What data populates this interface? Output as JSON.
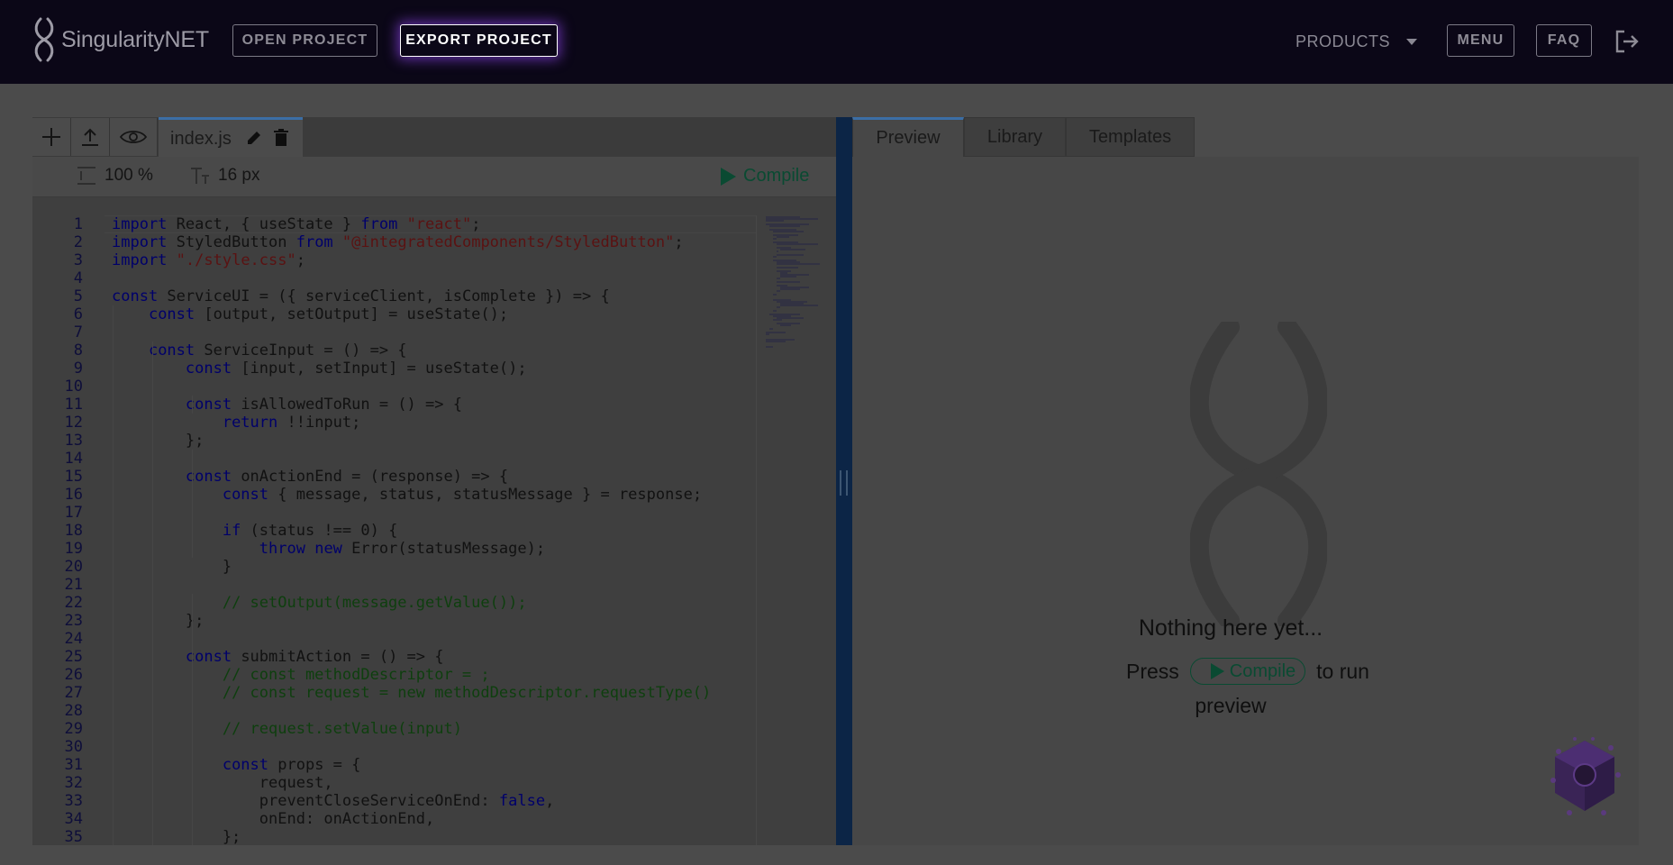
{
  "header": {
    "brand": "SingularityNET",
    "open_project": "OPEN PROJECT",
    "export_project": "EXPORT PROJECT",
    "products": "PRODUCTS",
    "menu": "MENU",
    "faq": "FAQ"
  },
  "editor": {
    "tab_filename": "index.js",
    "zoom": "100 %",
    "font_size": "16 px",
    "compile_label": "Compile",
    "code_lines": [
      "import React, { useState } from \"react\";",
      "import StyledButton from \"@integratedComponents/StyledButton\";",
      "import \"./style.css\";",
      "",
      "const ServiceUI = ({ serviceClient, isComplete }) => {",
      "    const [output, setOutput] = useState();",
      "",
      "    const ServiceInput = () => {",
      "        const [input, setInput] = useState();",
      "",
      "        const isAllowedToRun = () => {",
      "            return !!input;",
      "        };",
      "",
      "        const onActionEnd = (response) => {",
      "            const { message, status, statusMessage } = response;",
      "",
      "            if (status !== 0) {",
      "                throw new Error(statusMessage);",
      "            }",
      "",
      "            // setOutput(message.getValue());",
      "        };",
      "",
      "        const submitAction = () => {",
      "            // const methodDescriptor = ;",
      "            // const request = new methodDescriptor.requestType()",
      "",
      "            // request.setValue(input)",
      "",
      "            const props = {",
      "                request,",
      "                preventCloseServiceOnEnd: false,",
      "                onEnd: onActionEnd,",
      "            };"
    ]
  },
  "preview": {
    "tabs": [
      "Preview",
      "Library",
      "Templates"
    ],
    "empty_title": "Nothing here yet...",
    "press": "Press",
    "compile_label": "Compile",
    "to_run": "to run",
    "preview_word": "preview"
  },
  "colors": {
    "header_bg": "#0b0717",
    "accent_blue": "#3b6ea5",
    "compile_green": "#0a4a32"
  }
}
